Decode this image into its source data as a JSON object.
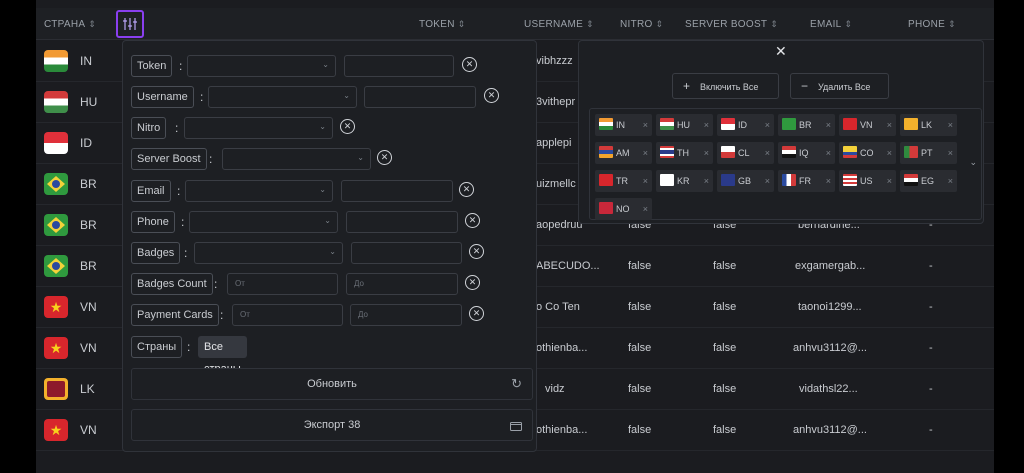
{
  "table": {
    "headers": {
      "country": "СТРАНА",
      "token": "TOKEN",
      "username": "USERNAME",
      "nitro": "NITRO",
      "server_boost": "SERVER BOOST",
      "email": "EMAIL",
      "phone": "PHONE"
    },
    "rows": [
      {
        "code": "IN",
        "username": "vibhzzz",
        "nitro": "",
        "boost": "",
        "email": "",
        "phone": ""
      },
      {
        "code": "HU",
        "username": "3vithepr",
        "nitro": "",
        "boost": "",
        "email": "",
        "phone": ""
      },
      {
        "code": "ID",
        "username": "applepi",
        "nitro": "",
        "boost": "",
        "email": "",
        "phone": ""
      },
      {
        "code": "BR",
        "username": "uizmellc",
        "nitro": "",
        "boost": "",
        "email": "",
        "phone": ""
      },
      {
        "code": "BR",
        "username": "aopedruu",
        "nitro": "false",
        "boost": "false",
        "email": "bernardine...",
        "phone": "-"
      },
      {
        "code": "BR",
        "username": "ABECUDO...",
        "nitro": "false",
        "boost": "false",
        "email": "exgamergab...",
        "phone": "-"
      },
      {
        "code": "VN",
        "username": "o Co Ten",
        "nitro": "false",
        "boost": "false",
        "email": "taonoi1299...",
        "phone": "-"
      },
      {
        "code": "VN",
        "username": "othienba...",
        "nitro": "false",
        "boost": "false",
        "email": "anhvu3112@...",
        "phone": "-"
      },
      {
        "code": "LK",
        "username": "vidz",
        "nitro": "false",
        "boost": "false",
        "email": "vidathsl22...",
        "phone": "-"
      },
      {
        "code": "VN",
        "username": "othienba...",
        "nitro": "false",
        "boost": "false",
        "email": "anhvu3112@...",
        "phone": "-"
      }
    ]
  },
  "filters": {
    "token": "Token",
    "username": "Username",
    "nitro": "Nitro",
    "server_boost": "Server Boost",
    "email": "Email",
    "phone": "Phone",
    "badges": "Badges",
    "badges_count": "Badges Count",
    "payment_cards": "Payment Cards",
    "countries": "Страны",
    "from_placeholder": "От",
    "to_placeholder": "До",
    "all_countries": "Все страны",
    "refresh": "Обновить",
    "export": "Экспорт 38"
  },
  "countries_panel": {
    "enable_all": "Включить Все",
    "remove_all": "Удалить Все",
    "tags": [
      "IN",
      "HU",
      "ID",
      "BR",
      "VN",
      "LK",
      "AM",
      "TH",
      "CL",
      "IQ",
      "CO",
      "PT",
      "TR",
      "KR",
      "GB",
      "FR",
      "US",
      "EG",
      "NO"
    ]
  },
  "colors": {
    "accent": "#8a3ff0",
    "background": "#1b1c20",
    "panel": "#1d1f23"
  }
}
